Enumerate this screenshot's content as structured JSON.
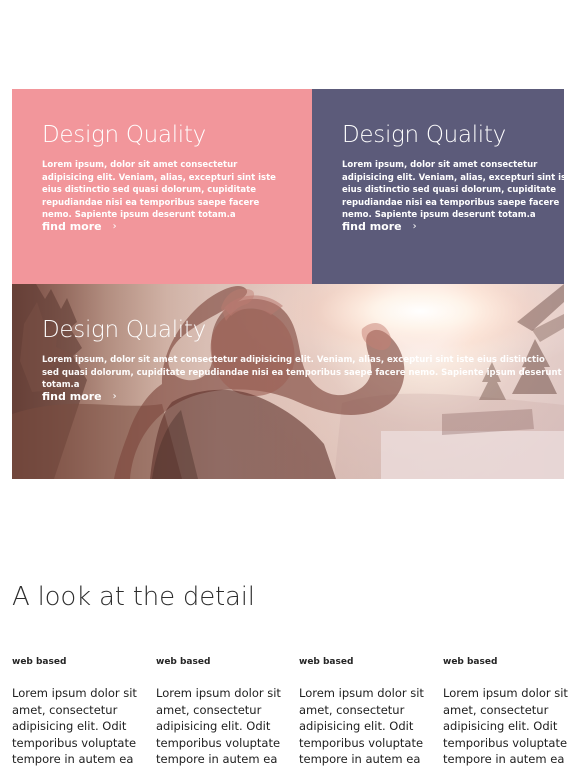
{
  "features": [
    {
      "title": "Design Quality",
      "description": "Lorem ipsum, dolor sit amet consectetur adipisicing elit. Veniam, alias, excepturi sint iste eius distinctio sed quasi dolorum, cupiditate repudiandae nisi ea temporibus saepe facere nemo. Sapiente ipsum deserunt totam.a",
      "link_label": "find more",
      "arrow_icon": "›",
      "background": "#f2969b"
    },
    {
      "title": "Design Quality",
      "description": "Lorem ipsum, dolor sit amet consectetur adipisicing elit. Veniam, alias, excepturi sint iste eius distinctio sed quasi dolorum, cupiditate repudiandae nisi ea temporibus saepe facere nemo. Sapiente ipsum deserunt totam.a",
      "link_label": "find more",
      "arrow_icon": "›",
      "background": "#5c5b7a"
    }
  ],
  "banner": {
    "title": "Design Quality",
    "description": "Lorem ipsum, dolor sit amet consectetur adipisicing elit. Veniam, alias, excepturi sint iste eius distinctio sed quasi dolorum, cupiditate repudiandae nisi ea temporibus saepe facere nemo. Sapiente ipsum deserunt totam.a",
    "link_label": "find more",
    "arrow_icon": "›"
  },
  "details": {
    "title": "A look at the detail",
    "items": [
      {
        "label": "web based",
        "text": "Lorem ipsum dolor sit amet, consectetur adipisicing elit. Odit temporibus voluptate tempore in autem ea"
      },
      {
        "label": "web based",
        "text": "Lorem ipsum dolor sit amet, consectetur adipisicing elit. Odit temporibus voluptate tempore in autem ea"
      },
      {
        "label": "web based",
        "text": "Lorem ipsum dolor sit amet, consectetur adipisicing elit. Odit temporibus voluptate tempore in autem ea"
      },
      {
        "label": "web based",
        "text": "Lorem ipsum dolor sit amet, consectetur adipisicing elit. Odit temporibus voluptate tempore in autem ea"
      }
    ]
  }
}
